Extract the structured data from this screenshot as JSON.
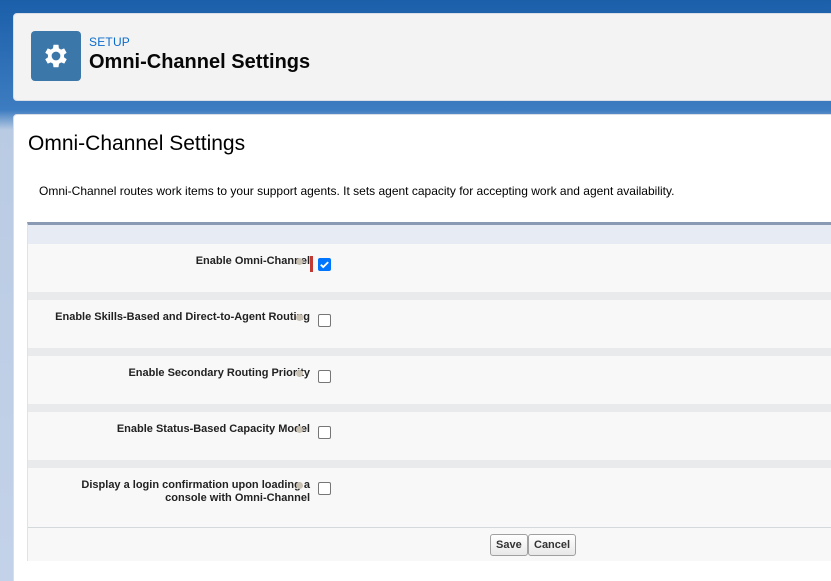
{
  "header": {
    "breadcrumb": "SETUP",
    "title": "Omni-Channel Settings"
  },
  "main": {
    "title": "Omni-Channel Settings",
    "description": "Omni-Channel routes work items to your support agents. It sets agent capacity for accepting work and agent availability."
  },
  "settings": [
    {
      "label": "Enable Omni-Channel",
      "checked": true,
      "required": true
    },
    {
      "label": "Enable Skills-Based and Direct-to-Agent Routing",
      "checked": false
    },
    {
      "label": "Enable Secondary Routing Priority",
      "checked": false
    },
    {
      "label": "Enable Status-Based Capacity Model",
      "checked": false
    },
    {
      "label": "Display a login confirmation upon loading a console with Omni-Channel",
      "checked": false
    }
  ],
  "buttons": {
    "save": "Save",
    "cancel": "Cancel"
  },
  "colors": {
    "accent": "#3b77a9",
    "link": "#0b6bcb",
    "required": "#c23934",
    "checkbox_checked": "#0075ff"
  }
}
